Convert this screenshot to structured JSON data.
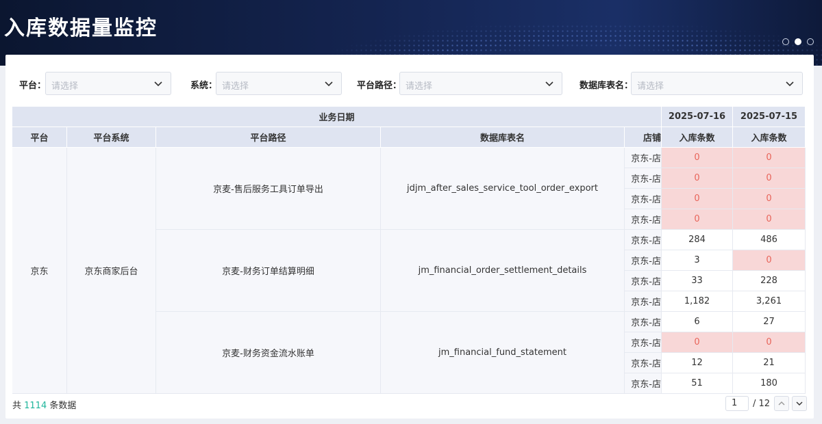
{
  "header": {
    "title": "入库数据量监控",
    "carousel_count": 3,
    "carousel_active": 1
  },
  "filters": [
    {
      "label": "平台：",
      "placeholder": "请选择"
    },
    {
      "label": "系统：",
      "placeholder": "请选择"
    },
    {
      "label": "平台路径：",
      "placeholder": "请选择"
    },
    {
      "label": "数据库表名：",
      "placeholder": "请选择"
    }
  ],
  "table": {
    "group_header": "业务日期",
    "columns": [
      "平台",
      "平台系统",
      "平台路径",
      "数据库表名",
      "店铺"
    ],
    "dates": [
      "2025-07-16",
      "2025-07-15"
    ],
    "date_subheader": "入库条数",
    "platform": "京东",
    "system": "京东商家后台",
    "groups": [
      {
        "path": "京麦-售后服务工具订单导出",
        "table": "jdjm_after_sales_service_tool_order_export",
        "rows": [
          {
            "shop": "京东-店",
            "d1": "0",
            "d2": "0"
          },
          {
            "shop": "京东-店",
            "d1": "0",
            "d2": "0"
          },
          {
            "shop": "京东-店",
            "d1": "0",
            "d2": "0"
          },
          {
            "shop": "京东-店",
            "d1": "0",
            "d2": "0"
          }
        ]
      },
      {
        "path": "京麦-财务订单结算明细",
        "table": "jm_financial_order_settlement_details",
        "rows": [
          {
            "shop": "京东-店",
            "d1": "284",
            "d2": "486"
          },
          {
            "shop": "京东-店",
            "d1": "3",
            "d2": "0"
          },
          {
            "shop": "京东-店",
            "d1": "33",
            "d2": "228"
          },
          {
            "shop": "京东-店",
            "d1": "1,182",
            "d2": "3,261"
          }
        ]
      },
      {
        "path": "京麦-财务资金流水账单",
        "table": "jm_financial_fund_statement",
        "rows": [
          {
            "shop": "京东-店",
            "d1": "6",
            "d2": "27"
          },
          {
            "shop": "京东-店",
            "d1": "0",
            "d2": "0"
          },
          {
            "shop": "京东-店",
            "d1": "12",
            "d2": "21"
          },
          {
            "shop": "京东-店",
            "d1": "51",
            "d2": "180"
          }
        ]
      }
    ]
  },
  "footer": {
    "prefix": "共 ",
    "total": "1114",
    "suffix": " 条数据"
  },
  "pagination": {
    "current": "1",
    "total_label": "/ 12"
  },
  "colors": {
    "zero_bg": "#f8d7d7",
    "zero_text": "#e8645a",
    "accent": "#1fb59b",
    "header_bg": "#dfe4f1"
  }
}
